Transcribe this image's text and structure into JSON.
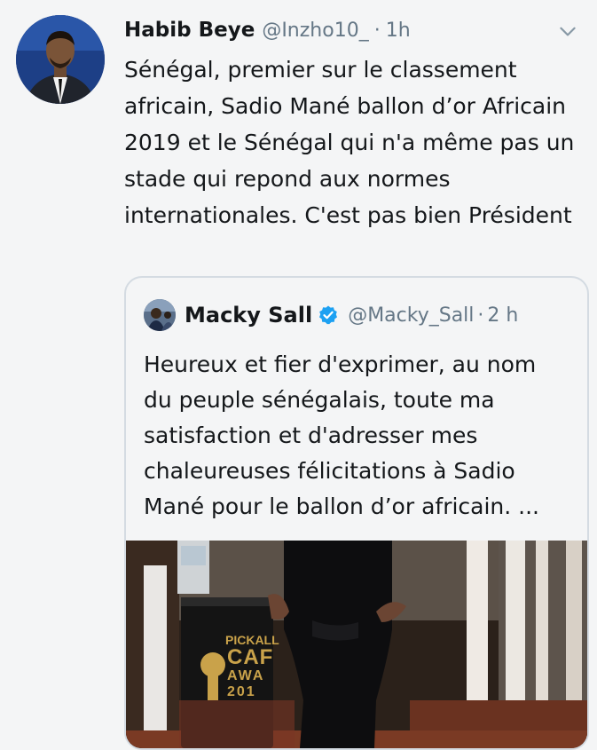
{
  "tweet": {
    "author_name": "Habib Beye",
    "author_handle": "@Inzho10_",
    "separator": "·",
    "time": "1h",
    "text": "Sénégal, premier sur le classement africain, Sadio Mané ballon d’or Africain 2019 et le Sénégal qui n'a même pas un stade qui repond aux normes internationales. C'est pas bien Président",
    "icons": {
      "menu": "chevron-down-icon",
      "verified": "verified-badge-icon"
    },
    "colors": {
      "verified": "#1da1f2",
      "secondary_text": "#657786",
      "border": "#d4dbe2"
    }
  },
  "quoted": {
    "author_name": "Macky Sall",
    "author_handle": "@Macky_Sall",
    "separator": "·",
    "time": "2 h",
    "text": "Heureux et fier d'exprimer, au nom du peuple sénégalais, toute ma satisfaction et d'adresser mes chaleureuses félicitations à Sadio Mané pour le ballon d’or africain. ...",
    "media": {
      "sign_line1": "PICKALL",
      "sign_line2": "CAF",
      "sign_line3": "AWA",
      "sign_line4": "201"
    }
  }
}
